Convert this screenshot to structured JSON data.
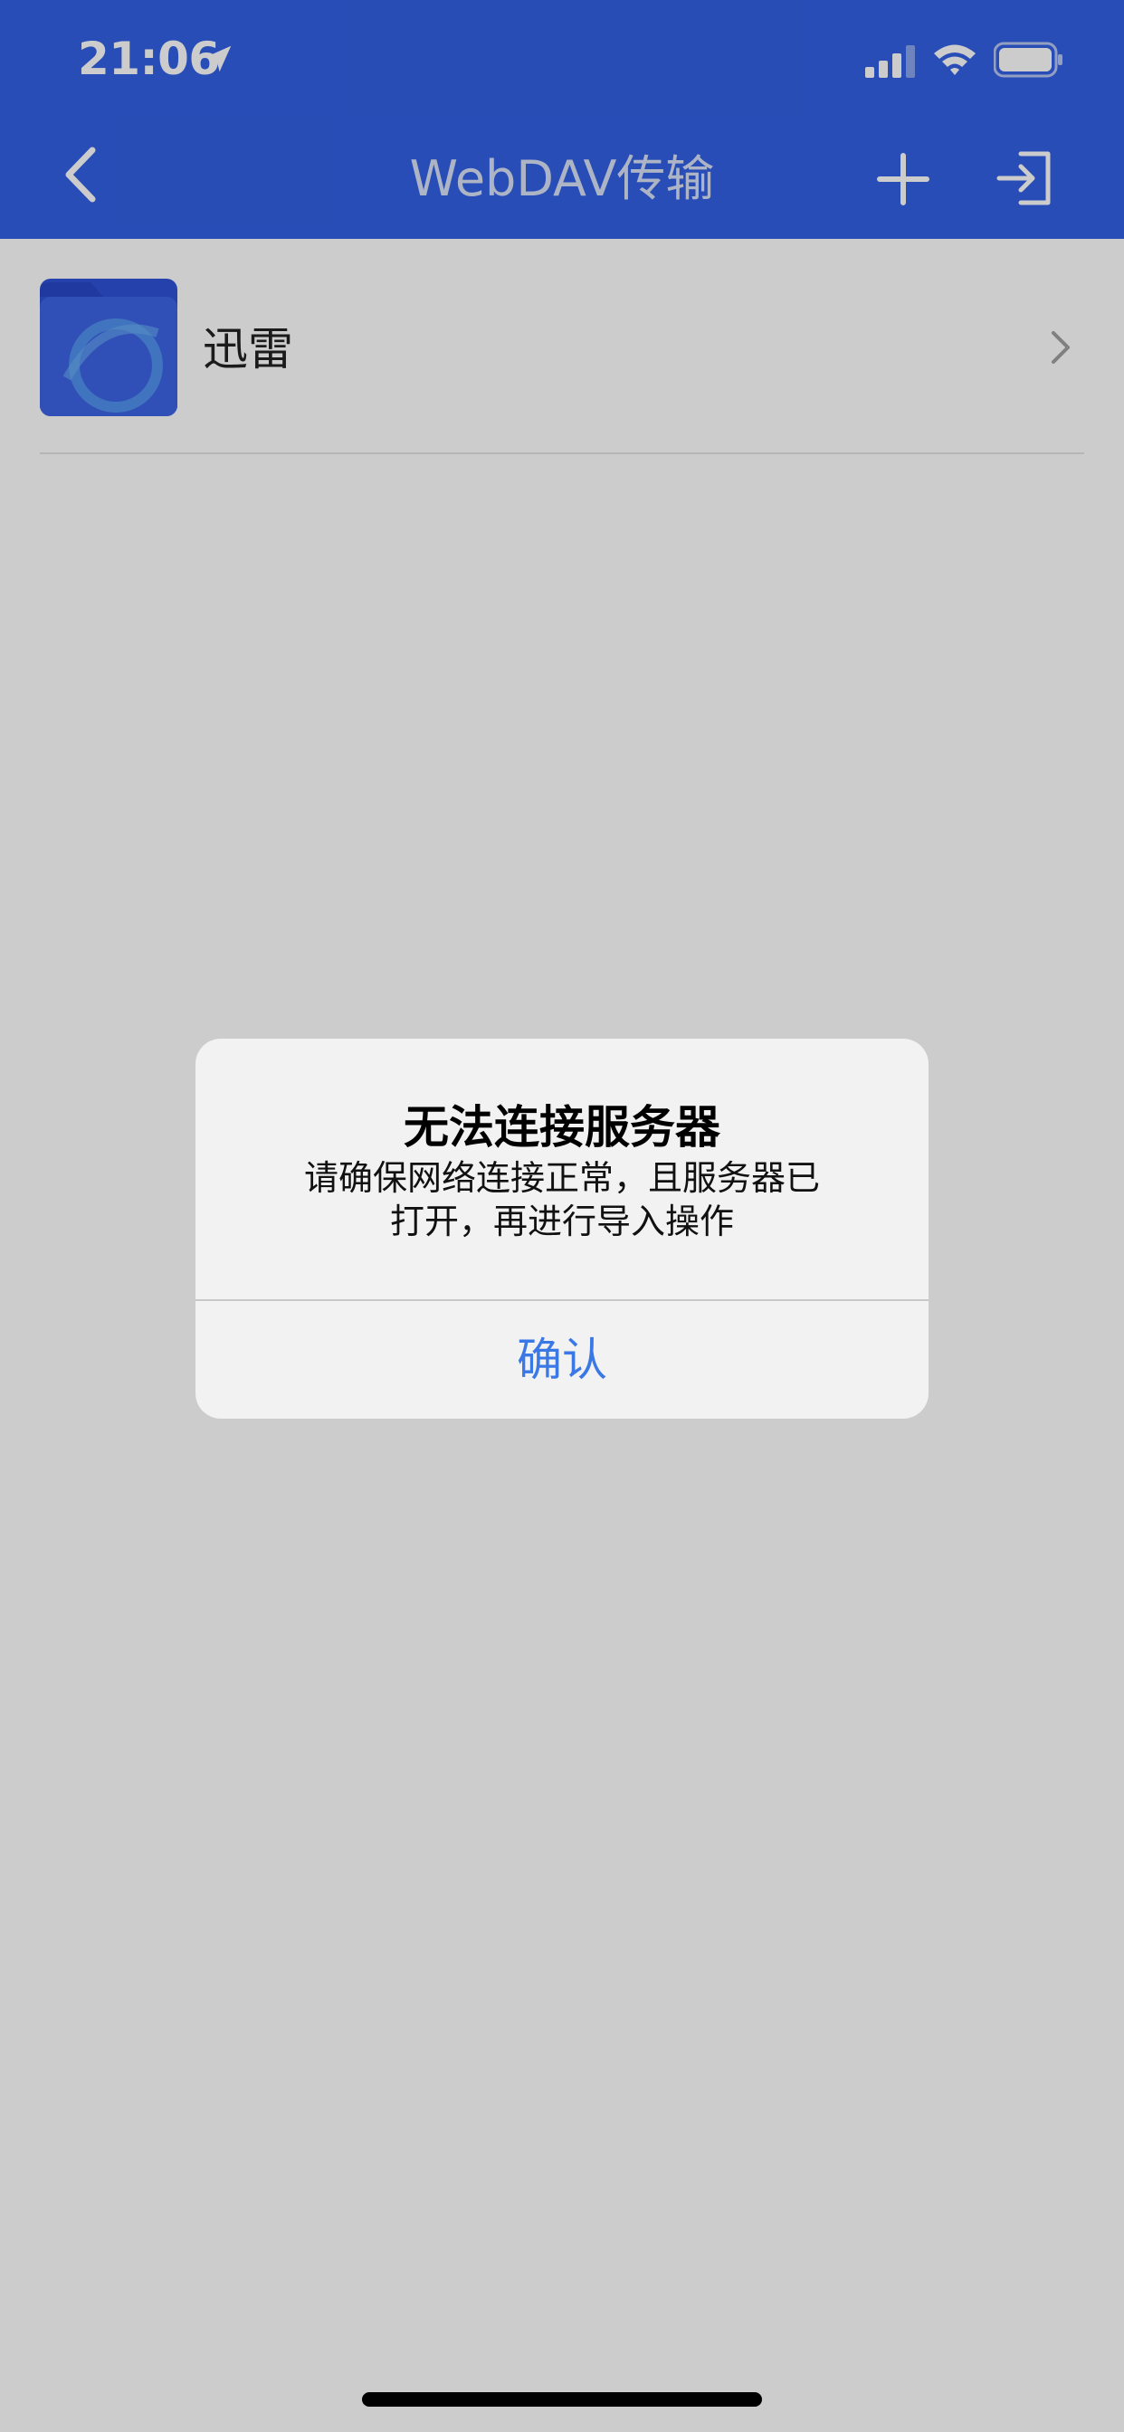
{
  "status_bar": {
    "time": "21:06",
    "location_icon": "location-arrow-icon",
    "signal_icon": "cellular-signal-icon",
    "wifi_icon": "wifi-icon",
    "battery_icon": "battery-icon"
  },
  "nav": {
    "title": "WebDAV传输",
    "back_icon": "chevron-left-icon",
    "add_icon": "plus-icon",
    "import_icon": "import-arrow-icon"
  },
  "list": {
    "items": [
      {
        "label": "迅雷",
        "icon": "folder-icon",
        "trailing_icon": "chevron-right-icon"
      }
    ]
  },
  "alert": {
    "title": "无法连接服务器",
    "message_line1": "请确保网络连接正常，且服务器已",
    "message_line2": "打开，再进行导入操作",
    "confirm_label": "确认"
  },
  "colors": {
    "header_background": "#3261e4",
    "alert_background": "#f2f2f2",
    "confirm_text": "#3a78e6",
    "overlay": "rgba(0,0,0,0.2)"
  }
}
